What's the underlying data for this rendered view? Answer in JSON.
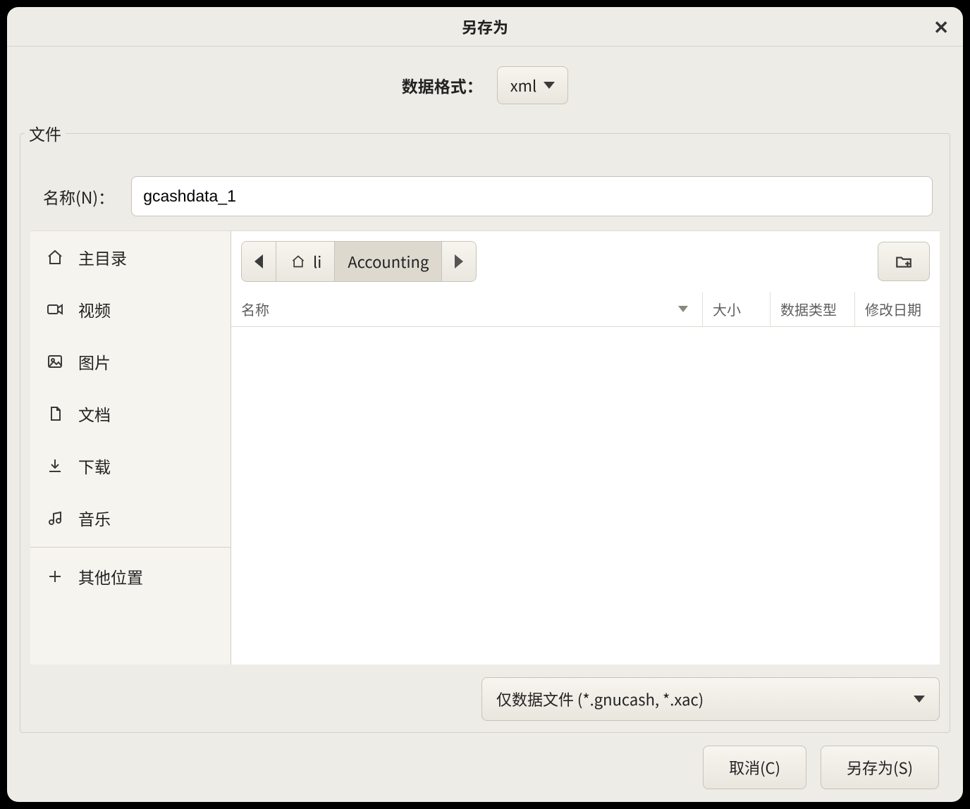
{
  "title": "另存为",
  "format": {
    "label": "数据格式：",
    "value": "xml"
  },
  "file_group_label": "文件",
  "name": {
    "label": "名称(N)：",
    "value": "gcashdata_1"
  },
  "sidebar": {
    "items": [
      {
        "icon": "home-icon",
        "label": "主目录"
      },
      {
        "icon": "video-icon",
        "label": "视频"
      },
      {
        "icon": "image-icon",
        "label": "图片"
      },
      {
        "icon": "document-icon",
        "label": "文档"
      },
      {
        "icon": "download-icon",
        "label": "下载"
      },
      {
        "icon": "music-icon",
        "label": "音乐"
      }
    ],
    "other": {
      "icon": "plus-icon",
      "label": "其他位置"
    }
  },
  "path": {
    "segments": [
      {
        "icon": "home-icon",
        "label": "li"
      },
      {
        "label": "Accounting",
        "active": true
      }
    ]
  },
  "columns": {
    "name": "名称",
    "size": "大小",
    "type": "数据类型",
    "date": "修改日期"
  },
  "filter": {
    "value": "仅数据文件 (*.gnucash, *.xac)"
  },
  "actions": {
    "cancel": "取消(C)",
    "save": "另存为(S)"
  }
}
